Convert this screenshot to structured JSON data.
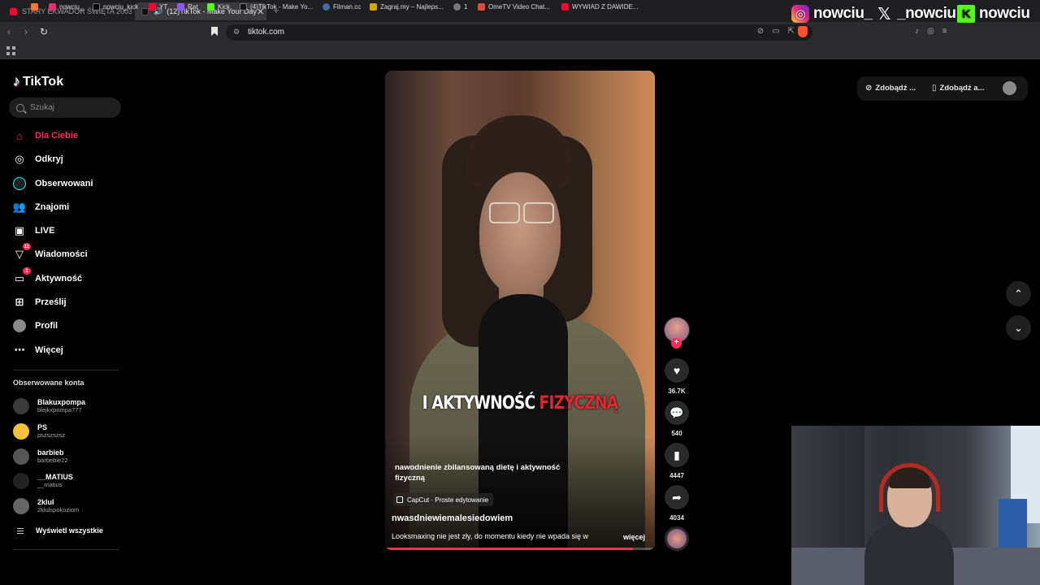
{
  "browser": {
    "tabs": [
      {
        "label": "STARY EKWADOR ŚWIĘTA 2003 -",
        "favicon_color": "#ff0033"
      },
      {
        "label": "(12)TikTok - Make Your Day",
        "favicon_color": "#111111"
      }
    ],
    "url": "tiktok.com",
    "bookmarks": [
      {
        "label": "",
        "color": "#ff7a30"
      },
      {
        "label": "nowciu_",
        "color": "#e1306c"
      },
      {
        "label": "nowciu_kick",
        "color": "#000000"
      },
      {
        "label": "YT",
        "color": "#ff0033"
      },
      {
        "label": "Rat",
        "color": "#8a5cf6"
      },
      {
        "label": "Kick",
        "color": "#53fc18"
      },
      {
        "label": "(4)TikTok - Make Yo...",
        "color": "#111111"
      },
      {
        "label": "Filman.cc",
        "color": "#3a6ea5"
      },
      {
        "label": "Zagraj.my – Najleps...",
        "color": "#d9a400"
      },
      {
        "label": "1",
        "color": "#777777"
      },
      {
        "label": "OmeTV Video Chat...",
        "color": "#e04a3a"
      },
      {
        "label": "WYWIAD Z DAWIDE...",
        "color": "#ff0033"
      }
    ]
  },
  "overlay": {
    "instagram": "nowciu_",
    "x": "_nowciu",
    "kick": "nowciu"
  },
  "sidebar": {
    "logo": "TikTok",
    "search_placeholder": "Szukaj",
    "nav": [
      {
        "label": "Dla Ciebie",
        "icon": "home-icon",
        "badge": ""
      },
      {
        "label": "Odkryj",
        "icon": "compass-icon",
        "badge": ""
      },
      {
        "label": "Obserwowani",
        "icon": "following-icon",
        "badge": ""
      },
      {
        "label": "Znajomi",
        "icon": "friends-icon",
        "badge": ""
      },
      {
        "label": "LIVE",
        "icon": "live-icon",
        "badge": ""
      },
      {
        "label": "Wiadomości",
        "icon": "messages-icon",
        "badge": "11"
      },
      {
        "label": "Aktywność",
        "icon": "activity-icon",
        "badge": "1"
      },
      {
        "label": "Prześlij",
        "icon": "upload-icon",
        "badge": ""
      },
      {
        "label": "Profil",
        "icon": "profile-icon",
        "badge": ""
      },
      {
        "label": "Więcej",
        "icon": "more-icon",
        "badge": ""
      }
    ],
    "followed_title": "Obserwowane konta",
    "followed": [
      {
        "name": "Blakuxpompa",
        "handle": "blejkxpompa777",
        "color": "#3a3a3a"
      },
      {
        "name": "PS",
        "handle": "pszszszsz",
        "color": "#f3c23a"
      },
      {
        "name": "barbieb",
        "handle": "barbebie22",
        "color": "#555555"
      },
      {
        "name": "__MATIUS",
        "handle": "__matius",
        "color": "#222222"
      },
      {
        "name": "2klul",
        "handle": "2klulspokoziom",
        "color": "#666666"
      }
    ],
    "show_all": "Wyświetl wszystkie"
  },
  "video": {
    "overlay_white": "I AKTYWNOŚĆ",
    "overlay_red": "FIZYCZNĄ",
    "text": "nawodnienie zbilansowaną dietę i aktywność fizyczną",
    "capcut": "CapCut · Proste edytowanie",
    "author": "nwasdniewiemalesiedowiem",
    "description": "Looksmaxing nie jest zły, do momentu kiedy nie wpada się w",
    "more": "więcej",
    "progress": 0.92
  },
  "actions": {
    "likes": "36.7K",
    "comments": "540",
    "saves": "4447",
    "shares": "4034"
  },
  "top_controls": {
    "btn1": "Zdobądź ...",
    "btn2": "Zdobądź a..."
  }
}
